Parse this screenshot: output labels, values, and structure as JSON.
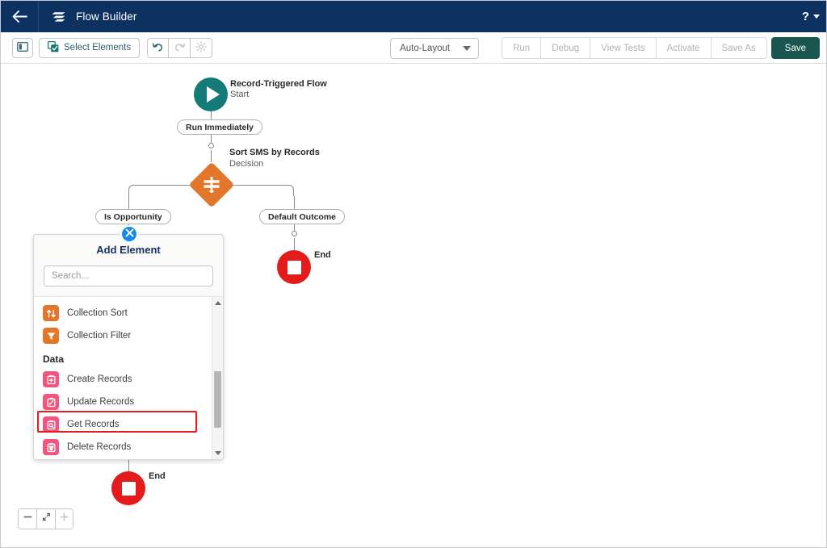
{
  "header": {
    "back_icon": "arrow-left-icon",
    "logo_icon": "flow-builder-logo-icon",
    "title": "Flow Builder",
    "help_label": "?",
    "bg_color": "#0d3262"
  },
  "toolbar": {
    "panel_toggle_icon": "side-panel-toggle-icon",
    "select_elements_label": "Select Elements",
    "select_elements_icon": "select-elements-icon",
    "undo_icon": "undo-icon",
    "redo_icon": "redo-icon",
    "settings_icon": "gear-icon",
    "layout_mode": "Auto-Layout",
    "actions": [
      {
        "label": "Run",
        "enabled": false
      },
      {
        "label": "Debug",
        "enabled": false
      },
      {
        "label": "View Tests",
        "enabled": false
      },
      {
        "label": "Activate",
        "enabled": false
      },
      {
        "label": "Save As",
        "enabled": false
      }
    ],
    "save_label": "Save",
    "save_color": "#19564f"
  },
  "canvas": {
    "start_node": {
      "label": "Record-Triggered Flow",
      "sublabel": "Start",
      "color": "#157b78",
      "icon": "play-icon"
    },
    "run_immediately_pill": "Run Immediately",
    "decision_node": {
      "label": "Sort SMS by Records",
      "sublabel": "Decision",
      "color": "#e2762a",
      "icon": "decision-signpost-icon"
    },
    "branch_left_pill": "Is Opportunity",
    "branch_right_pill": "Default Outcome",
    "end_right_label": "End",
    "end_bottom_label": "End",
    "end_color": "#e31b1b"
  },
  "add_panel": {
    "title": "Add Element",
    "close_icon": "close-icon",
    "search_placeholder": "Search...",
    "search_value": "",
    "items": [
      {
        "label": "Collection Sort",
        "icon": "collection-sort-icon",
        "color": "#e2762a",
        "type": "item",
        "highlighted": false
      },
      {
        "label": "Collection Filter",
        "icon": "collection-filter-icon",
        "color": "#e2762a",
        "type": "item",
        "highlighted": false
      },
      {
        "label": "Data",
        "icon": "",
        "color": "",
        "type": "section",
        "highlighted": false
      },
      {
        "label": "Create Records",
        "icon": "create-records-icon",
        "color": "#f2547d",
        "type": "item",
        "highlighted": false
      },
      {
        "label": "Update Records",
        "icon": "update-records-icon",
        "color": "#f2547d",
        "type": "item",
        "highlighted": false
      },
      {
        "label": "Get Records",
        "icon": "get-records-icon",
        "color": "#f2547d",
        "type": "item",
        "highlighted": true
      },
      {
        "label": "Delete Records",
        "icon": "delete-records-icon",
        "color": "#f2547d",
        "type": "item",
        "highlighted": false
      }
    ],
    "highlight_color": "#e81c1c",
    "scroll_up_icon": "scroll-up-arrow-icon",
    "scroll_down_icon": "scroll-down-arrow-icon"
  },
  "zoom_controls": {
    "zoom_out_icon": "minus-icon",
    "fit_icon": "fit-to-screen-icon",
    "zoom_in_icon": "plus-icon",
    "zoom_in_enabled": false
  }
}
